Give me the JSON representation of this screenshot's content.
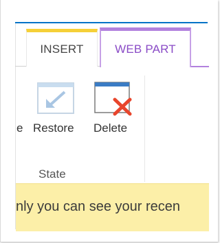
{
  "tabs": {
    "insert": "INSERT",
    "web_part": "WEB PART"
  },
  "commands": {
    "partial_prev": "e",
    "restore": "Restore",
    "delete": "Delete"
  },
  "group_label": "State",
  "notice": {
    "text": "nly you can see your recen"
  },
  "colors": {
    "accent_blue": "#0072c6",
    "insert_tab": "#f5d038",
    "web_part_tab": "#b281de",
    "notice_bg": "#fcefa8",
    "delete_x": "#e8452c"
  },
  "icons": {
    "restore": "restore-icon",
    "delete": "delete-icon"
  }
}
